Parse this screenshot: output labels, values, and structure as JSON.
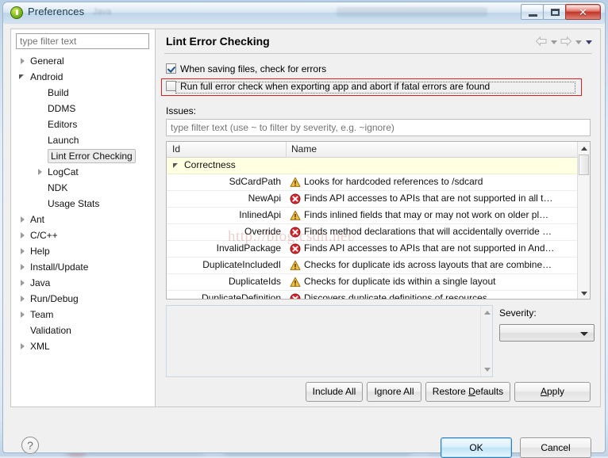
{
  "window": {
    "title": "Preferences",
    "ghost_text": "Java",
    "app_icon": "eclipse-icon",
    "buttons": {
      "minimize": "minimize-icon",
      "maximize": "maximize-icon",
      "close": "✕"
    }
  },
  "sidebar": {
    "filter_placeholder": "type filter text",
    "filter_value": "",
    "items": [
      {
        "label": "General",
        "indent": 0,
        "arrow": "collapsed",
        "selected": false
      },
      {
        "label": "Android",
        "indent": 0,
        "arrow": "expanded",
        "selected": false
      },
      {
        "label": "Build",
        "indent": 1,
        "arrow": "none",
        "selected": false
      },
      {
        "label": "DDMS",
        "indent": 1,
        "arrow": "none",
        "selected": false
      },
      {
        "label": "Editors",
        "indent": 1,
        "arrow": "none",
        "selected": false
      },
      {
        "label": "Launch",
        "indent": 1,
        "arrow": "none",
        "selected": false
      },
      {
        "label": "Lint Error Checking",
        "indent": 1,
        "arrow": "none",
        "selected": true
      },
      {
        "label": "LogCat",
        "indent": 1,
        "arrow": "collapsed",
        "selected": false
      },
      {
        "label": "NDK",
        "indent": 1,
        "arrow": "none",
        "selected": false
      },
      {
        "label": "Usage Stats",
        "indent": 1,
        "arrow": "none",
        "selected": false
      },
      {
        "label": "Ant",
        "indent": 0,
        "arrow": "collapsed",
        "selected": false
      },
      {
        "label": "C/C++",
        "indent": 0,
        "arrow": "collapsed",
        "selected": false
      },
      {
        "label": "Help",
        "indent": 0,
        "arrow": "collapsed",
        "selected": false
      },
      {
        "label": "Install/Update",
        "indent": 0,
        "arrow": "collapsed",
        "selected": false
      },
      {
        "label": "Java",
        "indent": 0,
        "arrow": "collapsed",
        "selected": false
      },
      {
        "label": "Run/Debug",
        "indent": 0,
        "arrow": "collapsed",
        "selected": false
      },
      {
        "label": "Team",
        "indent": 0,
        "arrow": "collapsed",
        "selected": false
      },
      {
        "label": "Validation",
        "indent": 0,
        "arrow": "none",
        "selected": false
      },
      {
        "label": "XML",
        "indent": 0,
        "arrow": "collapsed",
        "selected": false
      }
    ]
  },
  "page": {
    "title": "Lint Error Checking",
    "nav": {
      "back": "back-arrow-icon",
      "back_menu": "chevron-down-icon",
      "forward": "forward-arrow-icon",
      "forward_menu": "chevron-down-icon",
      "view_menu": "chevron-down-icon"
    },
    "checkboxes": [
      {
        "label": "When saving files, check for errors",
        "checked": true,
        "highlighted": false
      },
      {
        "label": "Run full error check when exporting app and abort if fatal errors are found",
        "checked": false,
        "highlighted": true
      }
    ],
    "issues_label": "Issues:",
    "issues_filter_placeholder": "type filter text (use ~ to filter by severity, e.g. ~ignore)",
    "issues_filter_value": "",
    "table": {
      "columns": [
        "Id",
        "Name"
      ],
      "rows": [
        {
          "id": "Correctness",
          "name": "",
          "icon": "none",
          "group": true
        },
        {
          "id": "SdCardPath",
          "name": "Looks for hardcoded references to /sdcard",
          "icon": "warning",
          "group": false
        },
        {
          "id": "NewApi",
          "name": "Finds API accesses to APIs that are not supported in all t…",
          "icon": "error",
          "group": false
        },
        {
          "id": "InlinedApi",
          "name": "Finds inlined fields that may or may not work on older pl…",
          "icon": "warning",
          "group": false
        },
        {
          "id": "Override",
          "name": "Finds method declarations that will accidentally override …",
          "icon": "error",
          "group": false
        },
        {
          "id": "InvalidPackage",
          "name": "Finds API accesses to APIs that are not supported in And…",
          "icon": "error",
          "group": false
        },
        {
          "id": "DuplicateIncludedI",
          "name": "Checks for duplicate ids across layouts that are combine…",
          "icon": "warning",
          "group": false
        },
        {
          "id": "DuplicateIds",
          "name": "Checks for duplicate ids within a single layout",
          "icon": "warning",
          "group": false
        },
        {
          "id": "DuplicateDefinition",
          "name": "Discovers duplicate definitions of resources",
          "icon": "error",
          "group": false
        }
      ]
    },
    "description_text": "",
    "severity_label": "Severity:",
    "severity_value": "",
    "buttons": {
      "include_all": "Include All",
      "ignore_all": "Ignore All",
      "restore_defaults_pre": "Restore ",
      "restore_defaults_key": "D",
      "restore_defaults_post": "efaults",
      "apply_key": "A",
      "apply_post": "pply"
    }
  },
  "footer": {
    "help": "?",
    "ok": "OK",
    "cancel": "Cancel"
  },
  "watermark": "http://blog.csdn.net/",
  "colors": {
    "group_row": "#ffffe1",
    "highlight_border": "#e02020",
    "warning": "#e8b024",
    "error": "#d9252b",
    "default_button_border": "#2f7fbf"
  }
}
